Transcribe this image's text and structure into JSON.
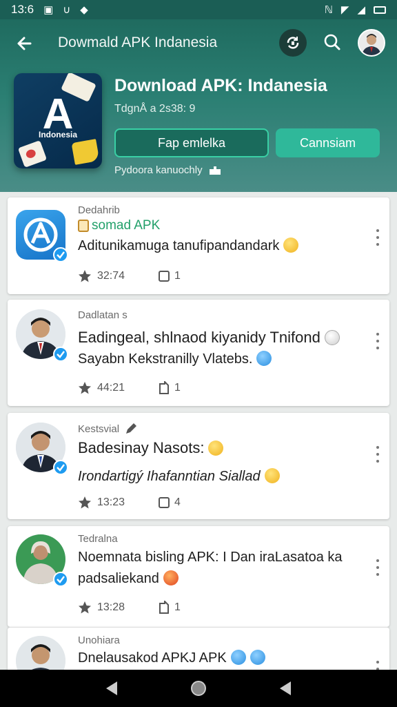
{
  "status_bar": {
    "time": "13:6"
  },
  "top_bar": {
    "title": "Dowmald APK Indanesia"
  },
  "app": {
    "icon_letter": "A",
    "icon_caption": "Indonesia",
    "title": "Download APK: Indanesia",
    "subtitle": "TdgnÅ a 2s38: 9",
    "primary_button": "Fap emlelka",
    "secondary_button": "Cannsiam",
    "note": "Pydoora kanuochly"
  },
  "feed": [
    {
      "meta": "Dedahrib",
      "source": "somad APK",
      "line1": "Aditunikamuga tanufipandandark",
      "line2": "",
      "stat1": "32:74",
      "stat2": "1",
      "emoji1": "yellow",
      "emoji2": ""
    },
    {
      "meta": "Dadlatan s",
      "source": "",
      "line1": "Eadingeal, shlnaod kiyanidy Tnifond",
      "line2": "Sayabn Kekstranilly Vlatebs.",
      "stat1": "44:21",
      "stat2": "1",
      "emoji1": "white",
      "emoji2": "blue"
    },
    {
      "meta": "Kestsvial",
      "source": "",
      "line1": "Badesinay Nasots:",
      "line2": "Irondartigý Ihafanntian Siallad",
      "stat1": "13:23",
      "stat2": "4",
      "emoji1": "yellow",
      "emoji2": "yellow"
    },
    {
      "meta": "Tedralna",
      "source": "",
      "line1": "Noemnata bisling APK: I Dan iraLasatoa ka",
      "line2": "padsaliekand",
      "stat1": "13:28",
      "stat2": "1",
      "emoji1": "",
      "emoji2": "red"
    },
    {
      "meta": "Unohiara",
      "source": "",
      "line1": "Dnelausakod APKJ APK",
      "line2": "",
      "stat1": "",
      "stat2": "",
      "emoji1": "blue",
      "emoji2": "blue"
    }
  ],
  "colors": {
    "header": "#1f6b5f",
    "accent": "#2fb89a",
    "verified": "#1e9bf0"
  }
}
